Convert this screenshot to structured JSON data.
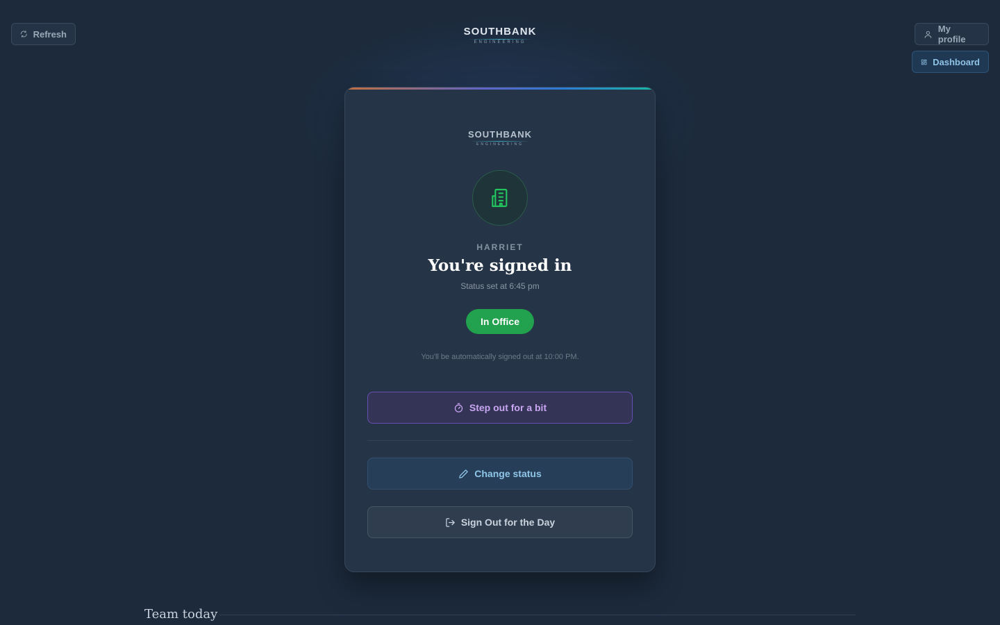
{
  "header": {
    "refresh_label": "Refresh",
    "profile_label": "My profile",
    "dashboard_label": "Dashboard",
    "logo_main": "SOUTHBANK",
    "logo_sub": "ENGINEERING"
  },
  "card": {
    "logo_main": "SOUTHBANK",
    "logo_sub": "ENGINEERING",
    "status_icon": "building-icon",
    "user_name": "HARRIET",
    "heading": "You're signed in",
    "status_time": "Status set at 6:45 pm",
    "status_badge": "In Office",
    "auto_signout_note": "You'll be automatically signed out at 10:00 PM.",
    "step_out_label": "Step out for a bit",
    "change_status_label": "Change status",
    "sign_out_label": "Sign Out for the Day"
  },
  "team": {
    "title": "Team today"
  },
  "colors": {
    "background": "#1c2a3b",
    "card": "#253446",
    "status_green": "#22a24e",
    "step_out_purple": "#c9a6f2",
    "change_status_blue": "#8fc6e8"
  }
}
